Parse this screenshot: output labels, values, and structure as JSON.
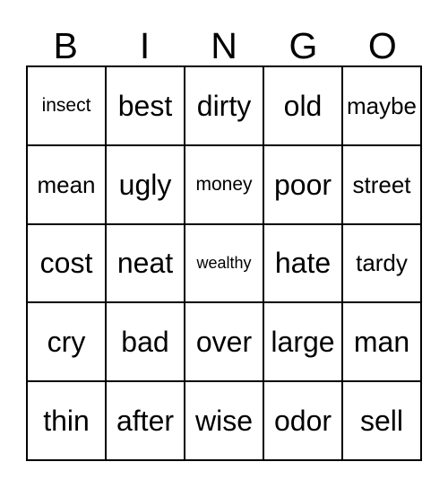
{
  "card": {
    "headers": [
      "B",
      "I",
      "N",
      "G",
      "O"
    ],
    "rows": [
      [
        {
          "word": "insect",
          "size": "sm"
        },
        {
          "word": "best",
          "size": "lg"
        },
        {
          "word": "dirty",
          "size": "lg"
        },
        {
          "word": "old",
          "size": "lg"
        },
        {
          "word": "maybe",
          "size": "md"
        }
      ],
      [
        {
          "word": "mean",
          "size": "md"
        },
        {
          "word": "ugly",
          "size": "lg"
        },
        {
          "word": "money",
          "size": "sm"
        },
        {
          "word": "poor",
          "size": "lg"
        },
        {
          "word": "street",
          "size": "md"
        }
      ],
      [
        {
          "word": "cost",
          "size": "lg"
        },
        {
          "word": "neat",
          "size": "lg"
        },
        {
          "word": "wealthy",
          "size": "xs"
        },
        {
          "word": "hate",
          "size": "lg"
        },
        {
          "word": "tardy",
          "size": "md"
        }
      ],
      [
        {
          "word": "cry",
          "size": "lg"
        },
        {
          "word": "bad",
          "size": "lg"
        },
        {
          "word": "over",
          "size": "lg"
        },
        {
          "word": "large",
          "size": "lg"
        },
        {
          "word": "man",
          "size": "lg"
        }
      ],
      [
        {
          "word": "thin",
          "size": "lg"
        },
        {
          "word": "after",
          "size": "lg"
        },
        {
          "word": "wise",
          "size": "lg"
        },
        {
          "word": "odor",
          "size": "lg"
        },
        {
          "word": "sell",
          "size": "lg"
        }
      ]
    ],
    "colors": {
      "border": "#000000",
      "text": "#000000",
      "background": "#ffffff"
    }
  }
}
